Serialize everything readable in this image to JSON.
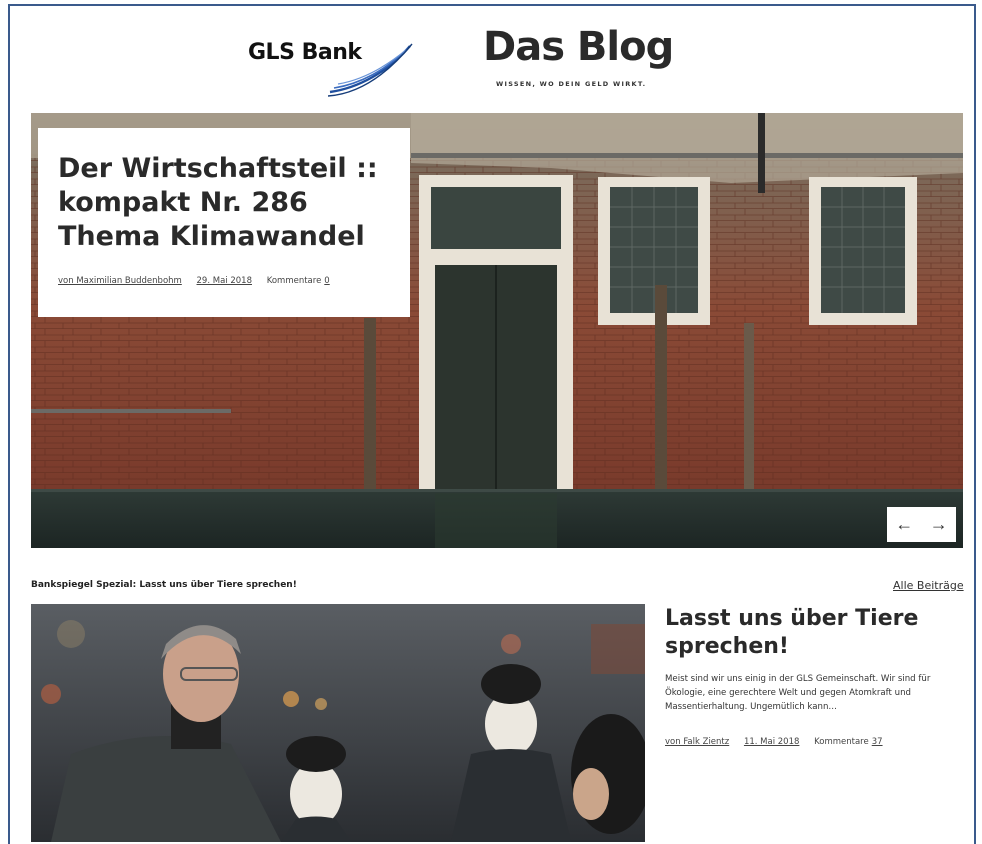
{
  "header": {
    "bank_name": "GLS Bank",
    "blog_title": "Das Blog",
    "tagline": "WISSEN, WO DEIN GELD WIRKT."
  },
  "hero": {
    "title": "Der Wirtschaftsteil :: kompakt Nr. 286 Thema Klimawandel",
    "author": "von Maximilian Buddenbohm",
    "date": "29. Mai 2018",
    "comments_label": "Kommentare",
    "comments_count": "0",
    "prev_arrow": "←",
    "next_arrow": "→"
  },
  "section": {
    "label": "Bankspiegel Spezial: Lasst uns über Tiere sprechen!",
    "all_posts": "Alle Beiträge"
  },
  "feature": {
    "title": "Lasst uns über Tiere sprechen!",
    "excerpt": "Meist sind wir uns einig in der GLS Gemeinschaft. Wir sind für Ökologie, eine gerechtere Welt und gegen Atomkraft und Massentierhaltung. Ungemütlich kann…",
    "author": "von Falk Zientz",
    "date": "11. Mai 2018",
    "comments_label": "Kommentare",
    "comments_count": "37"
  },
  "colors": {
    "frame": "#3a5a8c",
    "logo_swoosh": "#1f4f9e",
    "text": "#2a2a2a"
  }
}
